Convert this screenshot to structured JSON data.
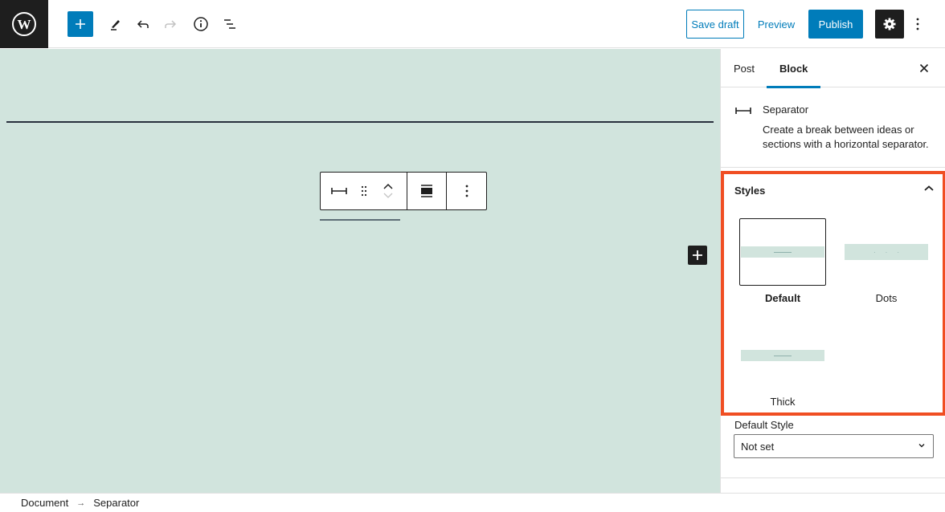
{
  "topbar": {
    "logo_icon": "wordpress-logo",
    "inserter_icon": "plus-icon",
    "tools_icon": "pencil-icon",
    "undo_icon": "undo-icon",
    "redo_icon": "redo-icon",
    "details_icon": "info-icon",
    "outline_icon": "list-view-icon",
    "save_draft_label": "Save draft",
    "preview_label": "Preview",
    "publish_label": "Publish",
    "settings_icon": "gear-icon",
    "more_icon": "kebab-icon"
  },
  "block_toolbar": {
    "block_icon": "separator-icon",
    "drag_icon": "drag-handle-icon",
    "move_up_icon": "chevron-up-icon",
    "move_down_icon": "chevron-down-icon",
    "align_icon": "align-wide-icon",
    "options_icon": "kebab-icon"
  },
  "sidebar": {
    "tabs": [
      {
        "label": "Post",
        "active": false
      },
      {
        "label": "Block",
        "active": true
      }
    ],
    "block_card": {
      "title": "Separator",
      "description": "Create a break between ideas or sections with a horizontal separator."
    },
    "styles": {
      "title": "Styles",
      "items": [
        {
          "label": "Default",
          "active": true
        },
        {
          "label": "Dots",
          "active": false
        },
        {
          "label": "Thick",
          "active": false
        }
      ]
    },
    "default_style": {
      "label": "Default Style",
      "value": "Not set"
    }
  },
  "footer": {
    "breadcrumb": [
      "Document",
      "Separator"
    ],
    "separator": "→"
  },
  "colors": {
    "accent": "#007cba",
    "canvas_bg": "#d1e4dd",
    "highlight": "#f04e23",
    "dark": "#1e1e1e"
  }
}
